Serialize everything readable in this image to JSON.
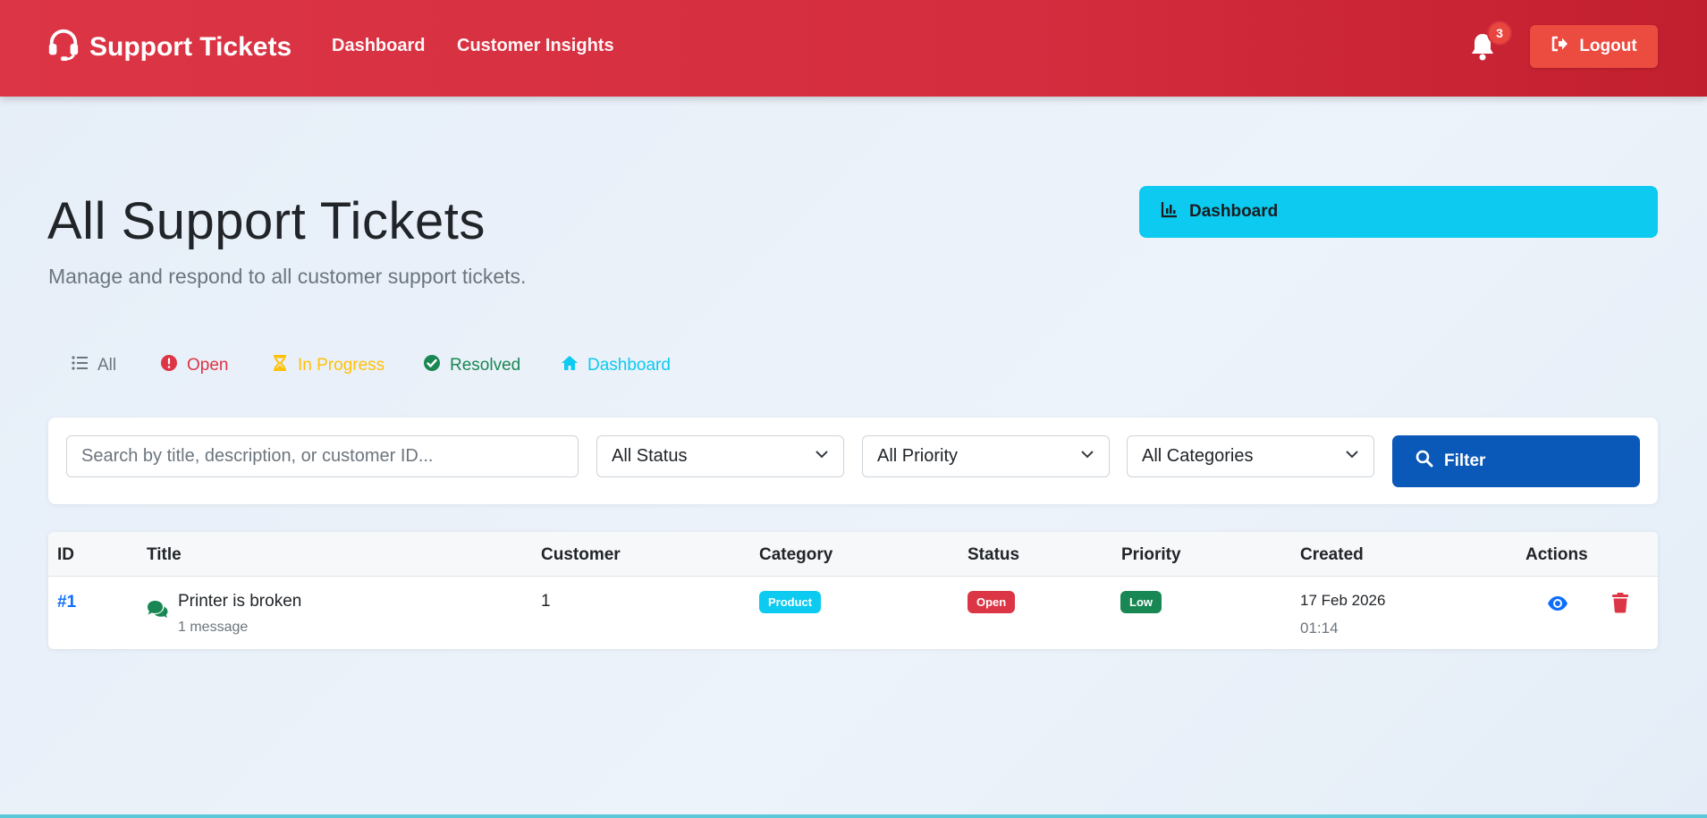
{
  "navbar": {
    "brand": "Support Tickets",
    "links": [
      "Dashboard",
      "Customer Insights"
    ],
    "notification_count": "3",
    "logout_label": "Logout"
  },
  "header": {
    "title": "All Support Tickets",
    "subtitle": "Manage and respond to all customer support tickets.",
    "dashboard_button": "Dashboard"
  },
  "tabs": [
    {
      "label": "All",
      "icon": "list-icon"
    },
    {
      "label": "Open",
      "icon": "exclamation-circle-icon"
    },
    {
      "label": "In Progress",
      "icon": "hourglass-icon"
    },
    {
      "label": "Resolved",
      "icon": "check-circle-icon"
    },
    {
      "label": "Dashboard",
      "icon": "home-icon"
    }
  ],
  "filters": {
    "search_placeholder": "Search by title, description, or customer ID...",
    "status": "All Status",
    "priority": "All Priority",
    "category": "All Categories",
    "filter_button": "Filter"
  },
  "table": {
    "columns": [
      "ID",
      "Title",
      "Customer",
      "Category",
      "Status",
      "Priority",
      "Created",
      "Actions"
    ],
    "rows": [
      {
        "id": "#1",
        "title": "Printer is broken",
        "messages": "1 message",
        "customer": "1",
        "category": "Product",
        "status": "Open",
        "priority": "Low",
        "created_date": "17 Feb 2026",
        "created_time": "01:14"
      }
    ]
  },
  "colors": {
    "navbar": "#dc3545",
    "logout": "#ec4b40",
    "dashboard_button": "#0dcaf0",
    "filter_button": "#0a58b8",
    "open": "#dc3545",
    "in_progress": "#ffc107",
    "resolved": "#198754",
    "info": "#0dcaf0"
  }
}
